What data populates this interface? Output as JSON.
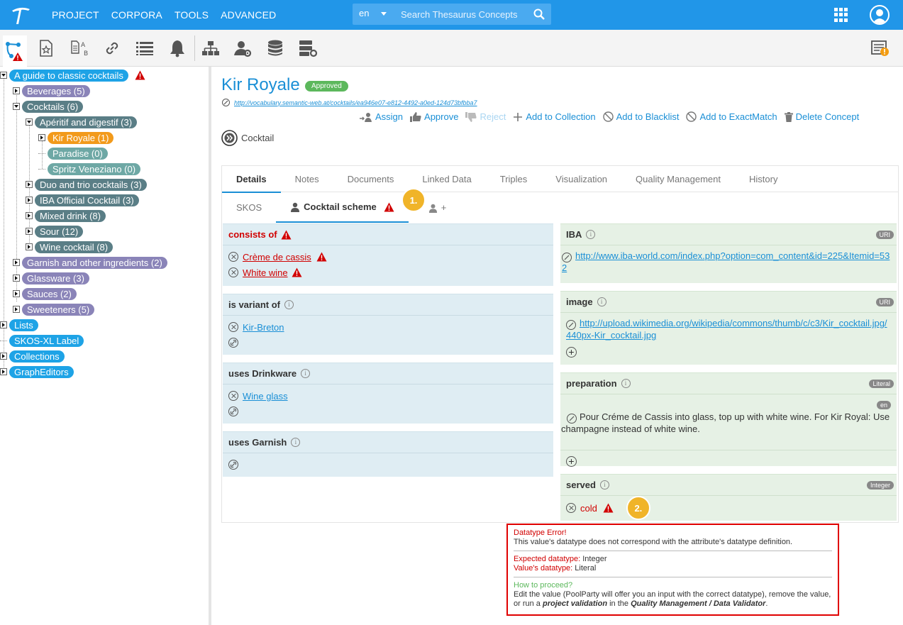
{
  "topbar": {
    "nav": [
      "PROJECT",
      "CORPORA",
      "TOOLS",
      "ADVANCED"
    ],
    "lang": "en",
    "search_placeholder": "Search Thesaurus Concepts"
  },
  "tree": [
    {
      "label": "A guide to classic cocktails",
      "color": "blue",
      "warn": true
    },
    {
      "label": "Beverages (5)",
      "color": "purple"
    },
    {
      "label": "Cocktails (6)",
      "color": "slate"
    },
    {
      "label": "Apéritif and digestif (3)",
      "color": "slate"
    },
    {
      "label": "Kir Royale (1)",
      "color": "orange"
    },
    {
      "label": "Paradise (0)",
      "color": "teal"
    },
    {
      "label": "Spritz Veneziano (0)",
      "color": "teal"
    },
    {
      "label": "Duo and trio cocktails (3)",
      "color": "slate"
    },
    {
      "label": "IBA Official Cocktail (3)",
      "color": "slate"
    },
    {
      "label": "Mixed drink (8)",
      "color": "slate"
    },
    {
      "label": "Sour (12)",
      "color": "slate"
    },
    {
      "label": "Wine cocktail (8)",
      "color": "slate"
    },
    {
      "label": "Garnish and other ingredients (2)",
      "color": "purple"
    },
    {
      "label": "Glassware (3)",
      "color": "purple"
    },
    {
      "label": "Sauces (2)",
      "color": "purple"
    },
    {
      "label": "Sweeteners (5)",
      "color": "purple"
    },
    {
      "label": "Lists",
      "color": "blue"
    },
    {
      "label": "SKOS-XL Label",
      "color": "blue"
    },
    {
      "label": "Collections",
      "color": "blue"
    },
    {
      "label": "GraphEditors",
      "color": "blue"
    }
  ],
  "concept": {
    "title": "Kir Royale",
    "status": "Approved",
    "uri": "http://vocabulary.semantic-web.at/cocktails/ea946e07-e812-4492-a0ed-124d73bfbba7",
    "type": "Cocktail"
  },
  "actions": [
    "Assign",
    "Approve",
    "Reject",
    "Add to Collection",
    "Add to Blacklist",
    "Add to ExactMatch",
    "Delete Concept"
  ],
  "tabs": [
    "Details",
    "Notes",
    "Documents",
    "Linked Data",
    "Triples",
    "Visualization",
    "Quality Management",
    "History"
  ],
  "subtabs": {
    "skos": "SKOS",
    "scheme": "Cocktail scheme",
    "badge1": "1.",
    "add": "+"
  },
  "left": {
    "consists_of": {
      "title": "consists of",
      "items": [
        "Crème de cassis",
        "White wine"
      ]
    },
    "is_variant_of": {
      "title": "is variant of",
      "items": [
        "Kir-Breton"
      ]
    },
    "uses_drinkware": {
      "title": "uses Drinkware",
      "items": [
        "Wine glass"
      ]
    },
    "uses_garnish": {
      "title": "uses Garnish"
    }
  },
  "right": {
    "iba": {
      "title": "IBA",
      "tag": "URI",
      "value": "http://www.iba-world.com/index.php?option=com_content&id=225&Itemid=532"
    },
    "image": {
      "title": "image",
      "tag": "URI",
      "value": "http://upload.wikimedia.org/wikipedia/commons/thumb/c/c3/Kir_cocktail.jpg/440px-Kir_cocktail.jpg"
    },
    "preparation": {
      "title": "preparation",
      "tag": "Literal",
      "lang": "en",
      "value": "Pour Créme de Cassis into glass, top up with white wine. For Kir Royal: Use champagne instead of white wine."
    },
    "served": {
      "title": "served",
      "tag": "Integer",
      "value": "cold",
      "badge2": "2."
    }
  },
  "error": {
    "title": "Datatype Error!",
    "desc": "This value's datatype does not correspond with the attribute's datatype definition.",
    "expected_label": "Expected datatype:",
    "expected": "Integer",
    "value_label": "Value's datatype:",
    "value": "Literal",
    "how": "How to proceed?",
    "p1": "Edit the value (PoolParty will offer you an input with the correct datatype), remove the value, or run a ",
    "p2": "project validation",
    "p3": " in the ",
    "p4": "Quality Management / Data Validator",
    "p5": "."
  }
}
